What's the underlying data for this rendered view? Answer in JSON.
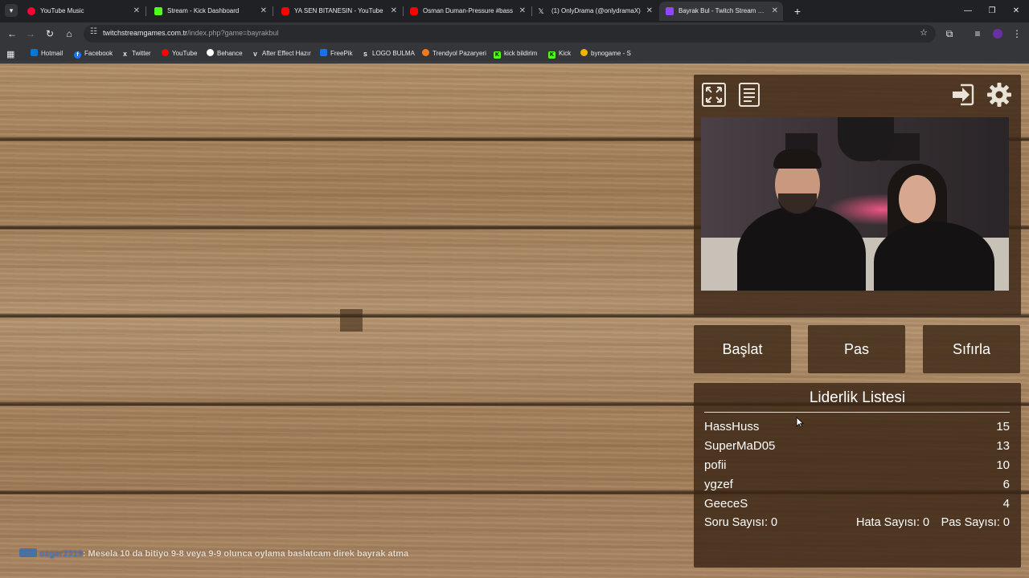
{
  "browser": {
    "tabs": [
      {
        "title": "YouTube Music",
        "color": "#ff0033"
      },
      {
        "title": "Stream - Kick Dashboard",
        "color": "#53fc18"
      },
      {
        "title": "YA SEN BITANESIN - YouTube",
        "color": "#ff0000"
      },
      {
        "title": "Osman Duman-Pressure #bass",
        "color": "#ff0000"
      },
      {
        "title": "(1) OnlyDrama (@onlydramaX)",
        "color": "#ffffff"
      },
      {
        "title": "Bayrak Bul - Twitch Stream Gam",
        "color": "#9147ff"
      }
    ],
    "url_host": "twitchstreamgames.com.tr",
    "url_path": "/index.php?game=bayrakbul",
    "bookmarks": [
      {
        "label": "Hotmail",
        "icon": "windows-icon",
        "color": "#0078d4"
      },
      {
        "label": "Facebook",
        "icon": "facebook-icon",
        "color": "#1877f2"
      },
      {
        "label": "Twitter",
        "icon": "x-icon",
        "color": "#000000"
      },
      {
        "label": "YouTube",
        "icon": "youtube-icon",
        "color": "#ff0000"
      },
      {
        "label": "Behance",
        "icon": "behance-icon",
        "color": "#ffffff"
      },
      {
        "label": "After Effect Hazır",
        "icon": "v-icon",
        "color": "#ffffff"
      },
      {
        "label": "FreePik",
        "icon": "freepik-icon",
        "color": "#1273eb"
      },
      {
        "label": "LOGO BULMA",
        "icon": "s-icon",
        "color": "#ffffff"
      },
      {
        "label": "Trendyol Pazaryeri",
        "icon": "trendyol-icon",
        "color": "#f27a1a"
      },
      {
        "label": "kick bildirim",
        "icon": "kick-icon",
        "color": "#53fc18"
      },
      {
        "label": "Kick",
        "icon": "kick-icon",
        "color": "#53fc18"
      },
      {
        "label": "bynogame - S",
        "icon": "bynogame-icon",
        "color": "#f0b400"
      }
    ]
  },
  "game": {
    "buttons": {
      "start": "Başlat",
      "pass": "Pas",
      "reset": "Sıfırla"
    },
    "leaderboard": {
      "title": "Liderlik Listesi",
      "rows": [
        {
          "name": "HassHuss",
          "score": "15"
        },
        {
          "name": "SuperMaD05",
          "score": "13"
        },
        {
          "name": "pofii",
          "score": "10"
        },
        {
          "name": "ygzef",
          "score": "6"
        },
        {
          "name": "GeeceS",
          "score": "4"
        }
      ]
    },
    "stats": {
      "questions": "Soru Sayısı: 0",
      "errors": "Hata Sayısı: 0",
      "passes": "Pas Sayısı: 0"
    },
    "chat": {
      "user": "ozger2319",
      "message": ": Mesela 10 da bitiyo 9-8 veya 9-9 olunca oylama baslatcam direk bayrak atma"
    }
  },
  "colors": {
    "panel": "#3a2616",
    "text": "#ffffff",
    "wood": "#a88563"
  }
}
